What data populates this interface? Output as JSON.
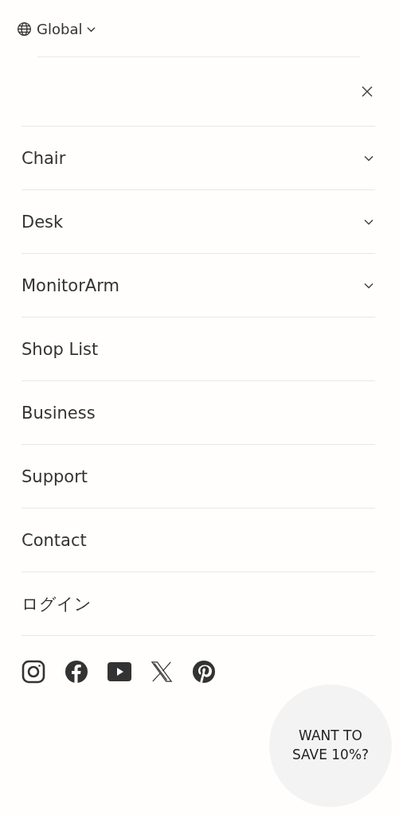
{
  "region_selector": {
    "label": "Global"
  },
  "menu": [
    {
      "label": "Chair",
      "expandable": true
    },
    {
      "label": "Desk",
      "expandable": true
    },
    {
      "label": "MonitorArm",
      "expandable": true
    },
    {
      "label": "Shop List",
      "expandable": false
    },
    {
      "label": "Business",
      "expandable": false
    },
    {
      "label": "Support",
      "expandable": false
    },
    {
      "label": "Contact",
      "expandable": false
    },
    {
      "label": "ログイン",
      "expandable": false
    }
  ],
  "promo_bubble": {
    "text": "WANT TO SAVE 10%?"
  }
}
